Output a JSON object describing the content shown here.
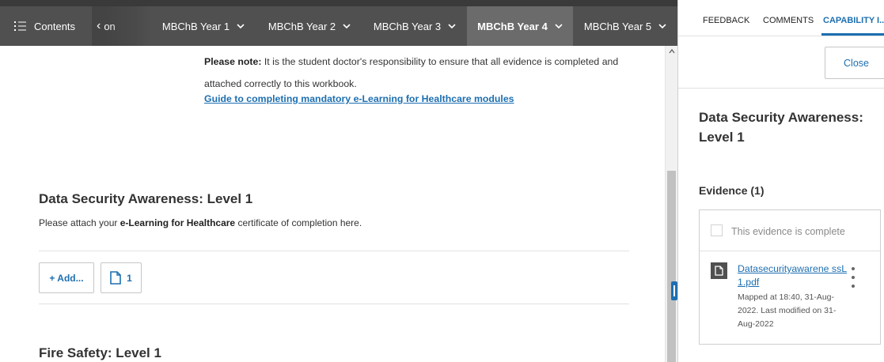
{
  "nav": {
    "contents_label": "Contents",
    "prev_label": "on",
    "tabs": [
      {
        "label": "MBChB Year 1",
        "active": false
      },
      {
        "label": "MBChB Year 2",
        "active": false
      },
      {
        "label": "MBChB Year 3",
        "active": false
      },
      {
        "label": "MBChB Year 4",
        "active": true
      },
      {
        "label": "MBChB Year 5",
        "active": false
      }
    ]
  },
  "main": {
    "note_label": "Please note:",
    "note_text": " It is the student doctor's responsibility to ensure that all evidence is completed and attached correctly to this workbook.",
    "guide_link": "Guide to completing mandatory e-Learning for Healthcare modules",
    "section1": {
      "title": "Data Security Awareness: Level 1",
      "desc_before": "Please attach your ",
      "desc_bold": "e-Learning for Healthcare",
      "desc_after": " certificate of completion here.",
      "add_button": "+ Add...",
      "attachment_count": "1"
    },
    "section2": {
      "title": "Fire Safety: Level 1"
    }
  },
  "panel": {
    "tabs": [
      {
        "label": "FEEDBACK",
        "active": false
      },
      {
        "label": "COMMENTS",
        "active": false
      },
      {
        "label": "CAPABILITY I...",
        "active": true
      }
    ],
    "close_label": "Close",
    "title": "Data Security Awareness: Level 1",
    "evidence_heading": "Evidence (1)",
    "complete_label": "This evidence is complete",
    "file_name": "Datasecurityawarene ssL1.pdf",
    "file_meta": "Mapped at 18:40, 31-Aug-2022. Last modified on 31-Aug-2022"
  },
  "colors": {
    "nav_bg": "#505050",
    "active_tab_bg": "#6b6b6b",
    "link": "#1d6fb1"
  }
}
